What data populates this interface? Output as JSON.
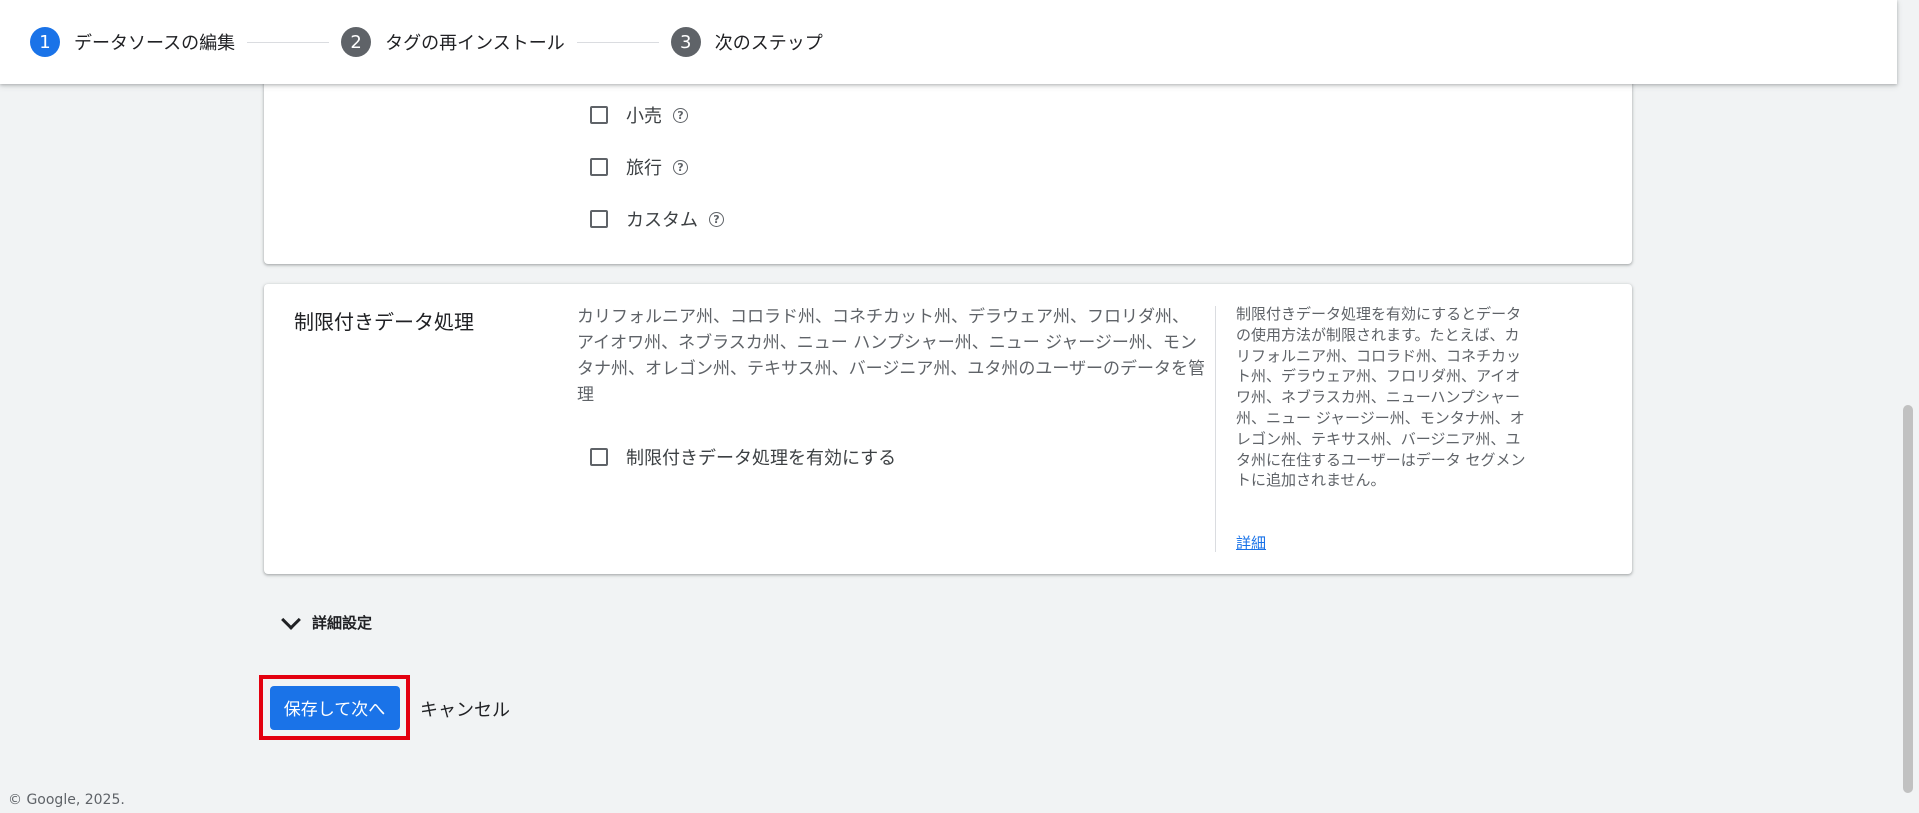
{
  "stepper": {
    "steps": [
      {
        "num": "1",
        "label": "データソースの編集"
      },
      {
        "num": "2",
        "label": "タグの再インストール"
      },
      {
        "num": "3",
        "label": "次のステップ"
      }
    ]
  },
  "industry_options": [
    {
      "label": "小売"
    },
    {
      "label": "旅行"
    },
    {
      "label": "カスタム"
    }
  ],
  "rdp": {
    "title": "制限付きデータ処理",
    "description": "カリフォルニア州、コロラド州、コネチカット州、デラウェア州、フロリダ州、アイオワ州、ネブラスカ州、ニュー ハンプシャー州、ニュー ジャージー州、モンタナ州、オレゴン州、テキサス州、バージニア州、ユタ州のユーザーのデータを管理",
    "checkbox_label": "制限付きデータ処理を有効にする",
    "side_text": "制限付きデータ処理を有効にするとデータの使用方法が制限されます。たとえば、カリフォルニア州、コロラド州、コネチカット州、デラウェア州、フロリダ州、アイオワ州、ネブラスカ州、ニューハンプシャー州、ニュー ジャージー州、モンタナ州、オレゴン州、テキサス州、バージニア州、ユタ州に在住するユーザーはデータ セグメントに追加されません。",
    "link": "詳細"
  },
  "advanced": {
    "label": "詳細設定"
  },
  "actions": {
    "save_next": "保存して次へ",
    "cancel": "キャンセル"
  },
  "footer": {
    "copyright": "© Google, 2025."
  },
  "help_glyph": "?"
}
